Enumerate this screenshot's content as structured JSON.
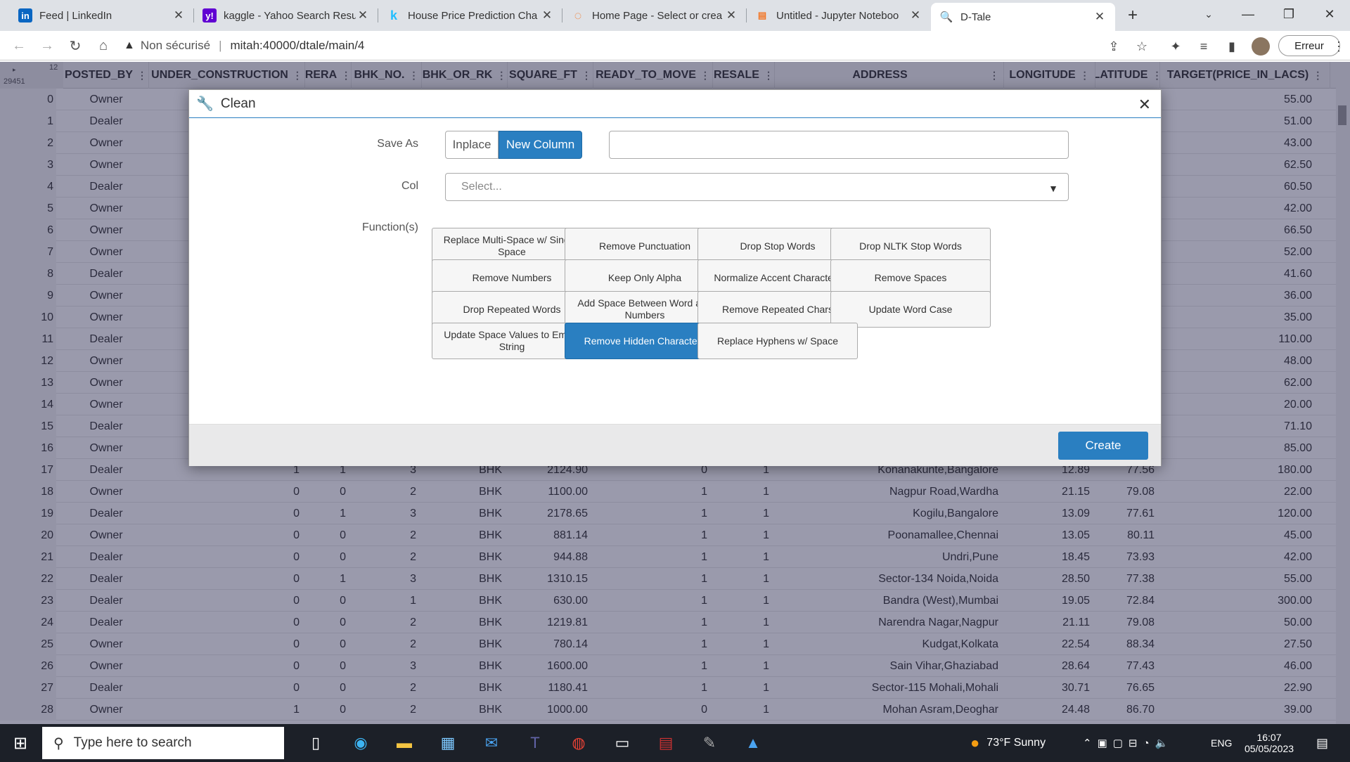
{
  "browser": {
    "tabs": [
      {
        "title": "Feed | LinkedIn",
        "icon": "in"
      },
      {
        "title": "kaggle - Yahoo Search Resu",
        "icon": "y!"
      },
      {
        "title": "House Price Prediction Cha",
        "icon": "k"
      },
      {
        "title": "Home Page - Select or crea",
        "icon": "◌"
      },
      {
        "title": "Untitled - Jupyter Noteboo",
        "icon": "▤"
      },
      {
        "title": "D-Tale",
        "icon": "🔍"
      }
    ],
    "new_tab": "+",
    "security_label": "Non sécurisé",
    "url": "mitah:40000/dtale/main/4",
    "error_button": "Erreur"
  },
  "grid": {
    "corner_count": "29451",
    "corner_top": "12",
    "columns": [
      "POSTED_BY",
      "UNDER_CONSTRUCTION",
      "RERA",
      "BHK_NO.",
      "BHK_OR_RK",
      "SQUARE_FT",
      "READY_TO_MOVE",
      "RESALE",
      "ADDRESS",
      "LONGITUDE",
      "LATITUDE",
      "TARGET(PRICE_IN_LACS)"
    ],
    "rows": [
      [
        "0",
        "Owner",
        "",
        "",
        "",
        "",
        "",
        "",
        "",
        "",
        "",
        "",
        "55.00"
      ],
      [
        "1",
        "Dealer",
        "",
        "",
        "",
        "",
        "",
        "",
        "",
        "",
        "",
        "",
        "51.00"
      ],
      [
        "2",
        "Owner",
        "",
        "",
        "",
        "",
        "",
        "",
        "",
        "",
        "",
        "",
        "43.00"
      ],
      [
        "3",
        "Owner",
        "",
        "",
        "",
        "",
        "",
        "",
        "",
        "",
        "",
        "",
        "62.50"
      ],
      [
        "4",
        "Dealer",
        "",
        "",
        "",
        "",
        "",
        "",
        "",
        "",
        "",
        "",
        "60.50"
      ],
      [
        "5",
        "Owner",
        "",
        "",
        "",
        "",
        "",
        "",
        "",
        "",
        "",
        "",
        "42.00"
      ],
      [
        "6",
        "Owner",
        "",
        "",
        "",
        "",
        "",
        "",
        "",
        "",
        "",
        "",
        "66.50"
      ],
      [
        "7",
        "Owner",
        "",
        "",
        "",
        "",
        "",
        "",
        "",
        "",
        "",
        "",
        "52.00"
      ],
      [
        "8",
        "Dealer",
        "",
        "",
        "",
        "",
        "",
        "",
        "",
        "",
        "",
        "",
        "41.60"
      ],
      [
        "9",
        "Owner",
        "",
        "",
        "",
        "",
        "",
        "",
        "",
        "",
        "",
        "",
        "36.00"
      ],
      [
        "10",
        "Owner",
        "",
        "",
        "",
        "",
        "",
        "",
        "",
        "",
        "",
        "",
        "35.00"
      ],
      [
        "11",
        "Dealer",
        "",
        "",
        "",
        "",
        "",
        "",
        "",
        "",
        "",
        "",
        "110.00"
      ],
      [
        "12",
        "Owner",
        "",
        "",
        "",
        "",
        "",
        "",
        "",
        "",
        "",
        "",
        "48.00"
      ],
      [
        "13",
        "Owner",
        "",
        "",
        "",
        "",
        "",
        "",
        "",
        "",
        "",
        "",
        "62.00"
      ],
      [
        "14",
        "Owner",
        "",
        "",
        "",
        "",
        "",
        "",
        "",
        "",
        "",
        "",
        "20.00"
      ],
      [
        "15",
        "Dealer",
        "",
        "",
        "",
        "",
        "",
        "",
        "",
        "",
        "",
        "",
        "71.10"
      ],
      [
        "16",
        "Owner",
        "",
        "",
        "",
        "",
        "",
        "",
        "",
        "",
        "",
        "",
        "85.00"
      ],
      [
        "17",
        "Dealer",
        "1",
        "1",
        "3",
        "BHK",
        "2124.90",
        "0",
        "1",
        "Konanakunte,Bangalore",
        "12.89",
        "77.56",
        "180.00"
      ],
      [
        "18",
        "Owner",
        "0",
        "0",
        "2",
        "BHK",
        "1100.00",
        "1",
        "1",
        "Nagpur Road,Wardha",
        "21.15",
        "79.08",
        "22.00"
      ],
      [
        "19",
        "Dealer",
        "0",
        "1",
        "3",
        "BHK",
        "2178.65",
        "1",
        "1",
        "Kogilu,Bangalore",
        "13.09",
        "77.61",
        "120.00"
      ],
      [
        "20",
        "Owner",
        "0",
        "0",
        "2",
        "BHK",
        "881.14",
        "1",
        "1",
        "Poonamallee,Chennai",
        "13.05",
        "80.11",
        "45.00"
      ],
      [
        "21",
        "Dealer",
        "0",
        "0",
        "2",
        "BHK",
        "944.88",
        "1",
        "1",
        "Undri,Pune",
        "18.45",
        "73.93",
        "42.00"
      ],
      [
        "22",
        "Dealer",
        "0",
        "1",
        "3",
        "BHK",
        "1310.15",
        "1",
        "1",
        "Sector-134 Noida,Noida",
        "28.50",
        "77.38",
        "55.00"
      ],
      [
        "23",
        "Dealer",
        "0",
        "0",
        "1",
        "BHK",
        "630.00",
        "1",
        "1",
        "Bandra (West),Mumbai",
        "19.05",
        "72.84",
        "300.00"
      ],
      [
        "24",
        "Dealer",
        "0",
        "0",
        "2",
        "BHK",
        "1219.81",
        "1",
        "1",
        "Narendra Nagar,Nagpur",
        "21.11",
        "79.08",
        "50.00"
      ],
      [
        "25",
        "Owner",
        "0",
        "0",
        "2",
        "BHK",
        "780.14",
        "1",
        "1",
        "Kudgat,Kolkata",
        "22.54",
        "88.34",
        "27.50"
      ],
      [
        "26",
        "Owner",
        "0",
        "0",
        "3",
        "BHK",
        "1600.00",
        "1",
        "1",
        "Sain Vihar,Ghaziabad",
        "28.64",
        "77.43",
        "46.00"
      ],
      [
        "27",
        "Dealer",
        "0",
        "0",
        "2",
        "BHK",
        "1180.41",
        "1",
        "1",
        "Sector-115 Mohali,Mohali",
        "30.71",
        "76.65",
        "22.90"
      ],
      [
        "28",
        "Owner",
        "1",
        "0",
        "2",
        "BHK",
        "1000.00",
        "0",
        "1",
        "Mohan Asram,Deoghar",
        "24.48",
        "86.70",
        "39.00"
      ]
    ]
  },
  "modal": {
    "title": "Clean",
    "save_as_label": "Save As",
    "inplace": "Inplace",
    "new_column": "New Column",
    "col_label": "Col",
    "col_placeholder": "Select...",
    "functions_label": "Function(s)",
    "functions": [
      "Replace Multi-Space w/ Single-Space",
      "Remove Punctuation",
      "Drop Stop Words",
      "Drop NLTK Stop Words",
      "Remove Numbers",
      "Keep Only Alpha",
      "Normalize Accent Characters",
      "Remove Spaces",
      "Drop Repeated Words",
      "Add Space Between Word and Numbers",
      "Remove Repeated Chars",
      "Update Word Case",
      "Update Space Values to Empty String",
      "Remove Hidden Characters",
      "Replace Hyphens w/ Space"
    ],
    "selected_function": "Remove Hidden Characters",
    "create": "Create"
  },
  "taskbar": {
    "search_placeholder": "Type here to search",
    "weather": "73°F  Sunny",
    "lang": "ENG",
    "time": "16:07",
    "date": "05/05/2023"
  },
  "colors": {
    "accent": "#2a7fc1",
    "overlay": "#1e1e46"
  }
}
